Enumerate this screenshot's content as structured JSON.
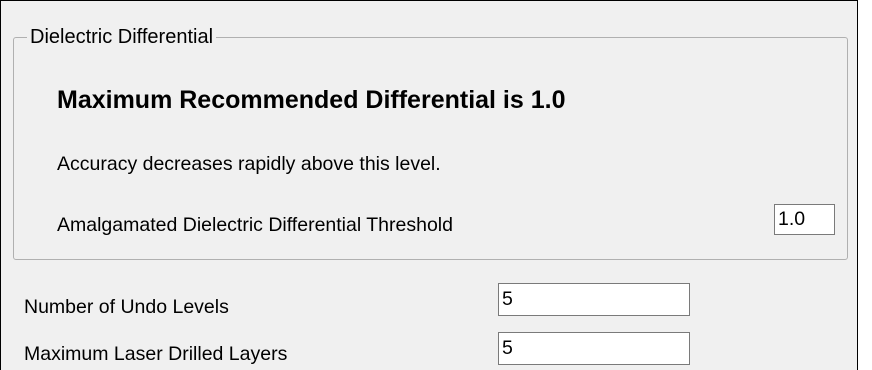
{
  "group": {
    "title": "Dielectric Differential",
    "heading": "Maximum Recommended Differential is 1.0",
    "note": "Accuracy decreases rapidly above this level.",
    "threshold_label": "Amalgamated Dielectric Differential Threshold",
    "threshold_value": "1.0"
  },
  "settings": {
    "undo_label": "Number of Undo Levels",
    "undo_value": "5",
    "laser_label": "Maximum Laser Drilled Layers",
    "laser_value": "5"
  }
}
